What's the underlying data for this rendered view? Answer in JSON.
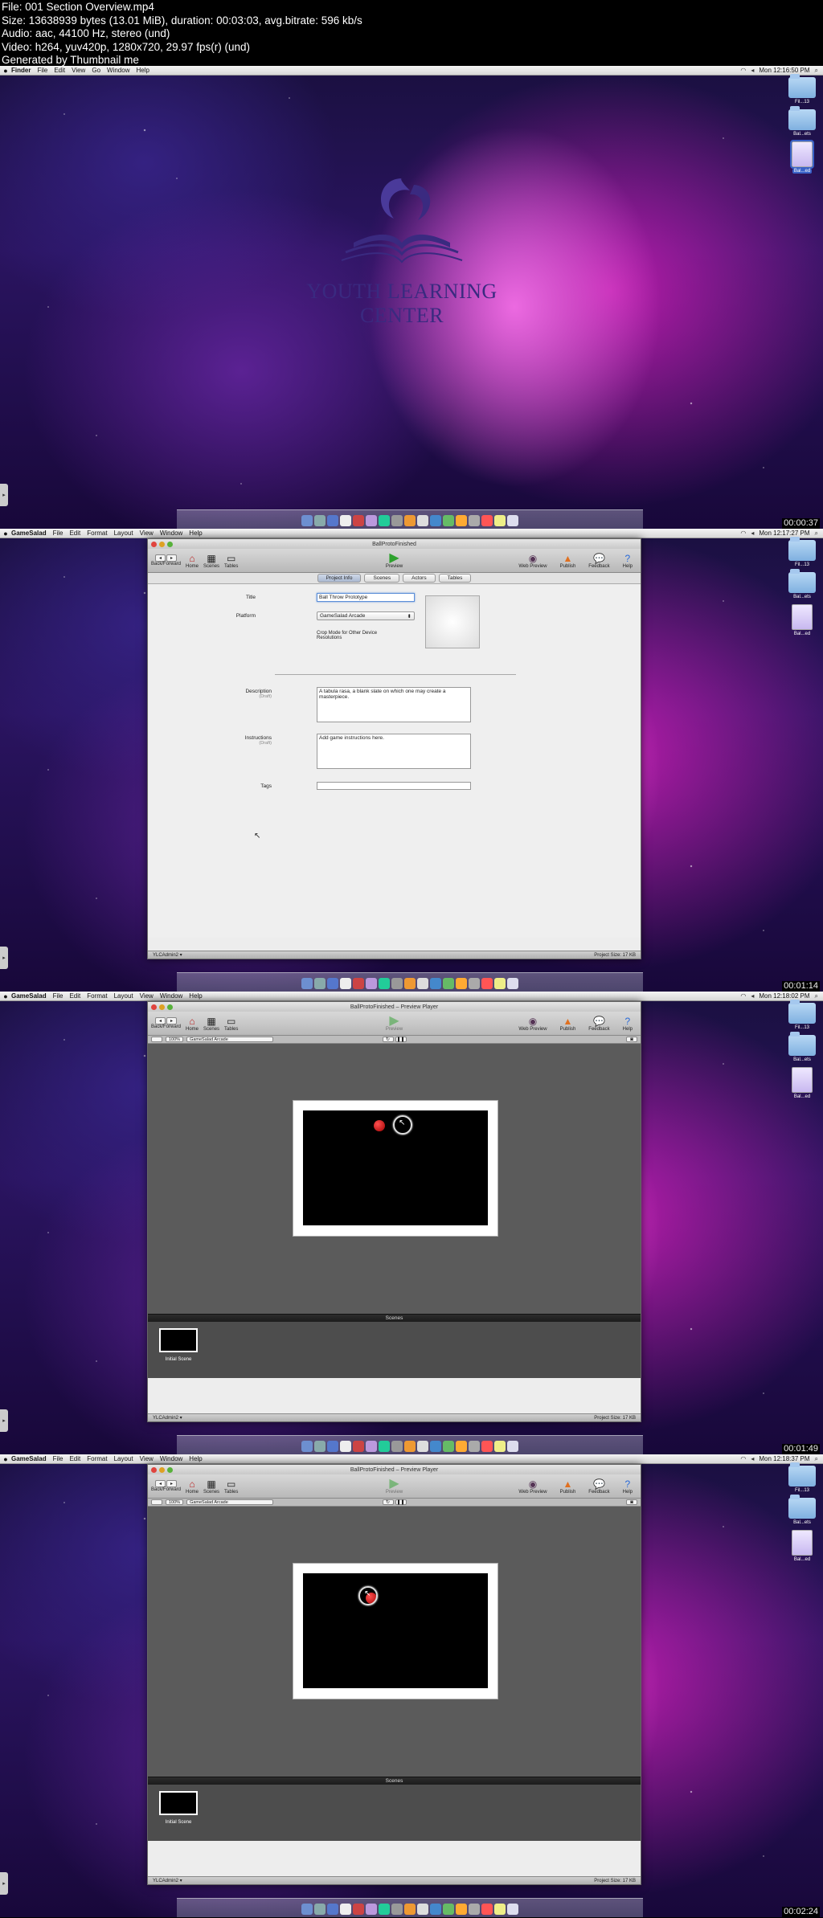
{
  "meta": {
    "lines": [
      "File: 001 Section Overview.mp4",
      "Size: 13638939 bytes (13.01 MiB), duration: 00:03:03, avg.bitrate: 596 kb/s",
      "Audio: aac, 44100 Hz, stereo (und)",
      "Video: h264, yuv420p, 1280x720, 29.97 fps(r) (und)",
      "Generated by Thumbnail me"
    ]
  },
  "desktop_icons": [
    {
      "label": "Fil...13",
      "kind": "folder",
      "selected": false
    },
    {
      "label": "Bal...ets",
      "kind": "folder",
      "selected": false
    },
    {
      "label": "Bal...ed",
      "kind": "document",
      "selected": true
    }
  ],
  "frames": [
    {
      "timestamp": "00:00:37",
      "menubar": {
        "app": "Finder",
        "items": [
          "File",
          "Edit",
          "View",
          "Go",
          "Window",
          "Help"
        ],
        "clock": "Mon 12:16:50 PM"
      },
      "logo_text": "YOUTH LEARNING CENTER"
    },
    {
      "timestamp": "00:01:14",
      "menubar": {
        "app": "GameSalad",
        "items": [
          "File",
          "Edit",
          "Format",
          "Layout",
          "View",
          "Window",
          "Help"
        ],
        "clock": "Mon 12:17:27 PM"
      },
      "window_title": "BallProtoFinished",
      "toolbar": {
        "backforward": "Back/Forward",
        "home": "Home",
        "scenes": "Scenes",
        "tables": "Tables",
        "preview": "Preview",
        "web_preview": "Web Preview",
        "publish": "Publish",
        "feedback": "Feedback",
        "help": "Help"
      },
      "tabs": [
        "Project Info",
        "Scenes",
        "Actors",
        "Tables"
      ],
      "form": {
        "title_label": "Title",
        "title_value": "Ball Throw Prototype",
        "platform_label": "Platform",
        "platform_value": "GameSalad Arcade",
        "crop_note": "Crop Mode for Other Device Resolutions",
        "description_label": "Description",
        "description_sub": "(Draft)",
        "description_value": "A tabula rasa, a blank slate on which one may create a masterpiece.",
        "instructions_label": "Instructions",
        "instructions_sub": "(Draft)",
        "instructions_value": "Add game instructions here.",
        "tags_label": "Tags",
        "tags_value": ""
      },
      "status": {
        "user": "YLCAdmin2 ▾",
        "project_size": "Project Size: 17 KB"
      }
    },
    {
      "timestamp": "00:01:49",
      "menubar": {
        "app": "GameSalad",
        "items": [
          "File",
          "Edit",
          "Format",
          "Layout",
          "View",
          "Window",
          "Help"
        ],
        "clock": "Mon 12:18:02 PM"
      },
      "window_title": "BallProtoFinished – Preview Player",
      "toolbar": {
        "backforward": "Back/Forward",
        "home": "Home",
        "scenes": "Scenes",
        "tables": "Tables",
        "preview": "Preview",
        "web_preview": "Web Preview",
        "publish": "Publish",
        "feedback": "Feedback",
        "help": "Help"
      },
      "preview": {
        "zoom": "100%",
        "platform": "GameSalad Arcade"
      },
      "scenes_title": "Scenes",
      "scene_label": "Initial Scene",
      "status": {
        "user": "YLCAdmin2 ▾",
        "project_size": "Project Size: 17 KB"
      }
    },
    {
      "timestamp": "00:02:24",
      "menubar": {
        "app": "GameSalad",
        "items": [
          "File",
          "Edit",
          "Format",
          "Layout",
          "View",
          "Window",
          "Help"
        ],
        "clock": "Mon 12:18:37 PM"
      },
      "window_title": "BallProtoFinished – Preview Player",
      "toolbar": {
        "backforward": "Back/Forward",
        "home": "Home",
        "scenes": "Scenes",
        "tables": "Tables",
        "preview": "Preview",
        "web_preview": "Web Preview",
        "publish": "Publish",
        "feedback": "Feedback",
        "help": "Help"
      },
      "preview": {
        "zoom": "100%",
        "platform": "GameSalad Arcade"
      },
      "scenes_title": "Scenes",
      "scene_label": "Initial Scene",
      "status": {
        "user": "YLCAdmin2 ▾",
        "project_size": "Project Size: 17 KB"
      }
    }
  ],
  "colors": {
    "accent": "#3a62c8",
    "preview_green": "#2da12d",
    "ball_red": "#c80000"
  }
}
